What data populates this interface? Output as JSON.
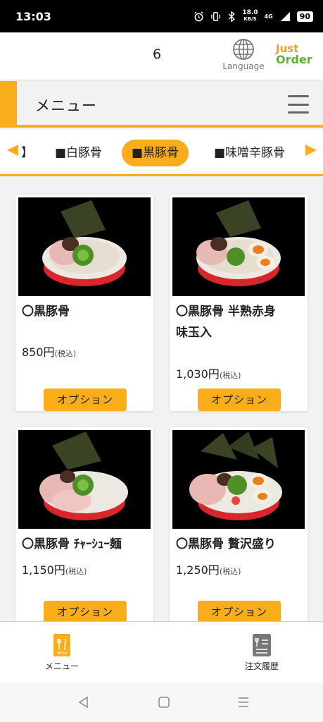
{
  "status_bar": {
    "time": "13:03",
    "speed_value": "18.0",
    "speed_unit": "KB/S",
    "network": "4G",
    "battery": "90",
    "icons": [
      "alarm-icon",
      "vibrate-icon",
      "bluetooth-icon",
      "signal-icon"
    ]
  },
  "header": {
    "table_number": "6",
    "language_label": "Language",
    "logo_line1": "Just",
    "logo_line2": "Order"
  },
  "title_bar": {
    "title": "メニュー"
  },
  "categories": {
    "partial_label": "】",
    "items": [
      {
        "label": "■白豚骨",
        "active": false
      },
      {
        "label": "■黒豚骨",
        "active": true
      },
      {
        "label": "■味噌辛豚骨",
        "active": false
      }
    ]
  },
  "menu_items": [
    {
      "name_line1": "〇黒豚骨",
      "name_line2": "",
      "price": "850円",
      "tax": "(税込)",
      "option_label": "オプション"
    },
    {
      "name_line1": "〇黒豚骨 半熟赤身",
      "name_line2": "味玉入",
      "price": "1,030円",
      "tax": "(税込)",
      "option_label": "オプション"
    },
    {
      "name_line1": "〇黒豚骨 ﾁｬｰｼｭｰ麺",
      "name_line2": "",
      "price": "1,150円",
      "tax": "(税込)",
      "option_label": "オプション"
    },
    {
      "name_line1": "〇黒豚骨 贅沢盛り",
      "name_line2": "",
      "price": "1,250円",
      "tax": "(税込)",
      "option_label": "オプション"
    }
  ],
  "bottom_nav": {
    "menu_label": "メニュー",
    "menu_icon_text": "MENU",
    "history_label": "注文履歴"
  },
  "colors": {
    "accent": "#f9ad1a",
    "logo_orange": "#f0a01e",
    "logo_green": "#63b131"
  }
}
